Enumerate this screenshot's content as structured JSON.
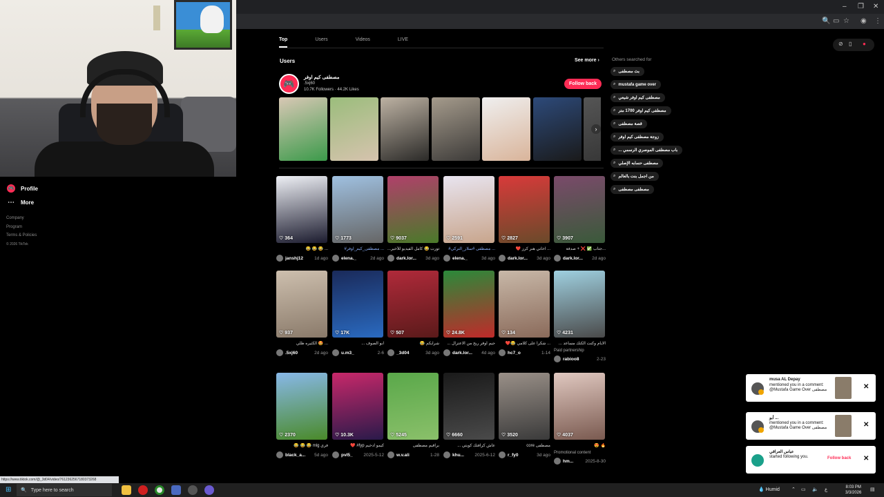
{
  "window": {
    "minimize": "–",
    "restore": "❐",
    "close": "✕"
  },
  "sidebar": {
    "items": [
      {
        "label": "Profile"
      },
      {
        "label": "More"
      }
    ],
    "footer": [
      "Company",
      "Program",
      "Terms & Policies",
      "© 2026 TikTok"
    ]
  },
  "tabs": [
    "Top",
    "Users",
    "Videos",
    "LIVE"
  ],
  "users_section": {
    "title": "Users",
    "see_more": "See more",
    "user": {
      "name": "مصطفى كيم اوفر",
      "id": ".5xj60",
      "stats": "10.7K Followers · 44.2K Likes",
      "follow_label": "Follow back"
    }
  },
  "strip_colors": [
    [
      "#d9c8b5",
      "#3b9a4a"
    ],
    [
      "#9bbd7c",
      "#d6c3ae"
    ],
    [
      "#bdb2a3",
      "#2b2a28"
    ],
    [
      "#a59b8c",
      "#3c3a38"
    ],
    [
      "#efefef",
      "#d9b49a"
    ],
    [
      "#2d4a7a",
      "#1a1a1a"
    ],
    [
      "#555",
      "#333"
    ]
  ],
  "videos": [
    {
      "count": "364",
      "desc": "😂 😂 😂 ...",
      "tag": false,
      "author": "janshj12",
      "date": "1d ago",
      "colors": [
        "#eef0f5",
        "#1b1b2e"
      ]
    },
    {
      "count": "1773",
      "desc": "#مصطفى_كيم_اوفر ...",
      "tag": true,
      "author": "elena._",
      "date": "2d ago",
      "colors": [
        "#9fc0e0",
        "#666"
      ]
    },
    {
      "count": "9037",
      "desc": "...فورت 😂 كامل الفيديو للأخير",
      "tag": false,
      "author": "dark.lor...",
      "date": "3d ago",
      "colors": [
        "#b0406a",
        "#4a7a2a"
      ]
    },
    {
      "count": "2591",
      "desc": "#مصطفى #سلار_التركي ...",
      "tag": true,
      "author": "elena._",
      "date": "3d ago",
      "colors": [
        "#e8e4ef",
        "#c8a58c"
      ]
    },
    {
      "count": "2827",
      "desc": "❤️ آخاني هنر كرز ...",
      "tag": false,
      "author": "dark.lor...",
      "date": "3d ago",
      "colors": [
        "#d83a3a",
        "#6a4a2a"
      ]
    },
    {
      "count": "3907",
      "desc": "جتاب ✅ ❌ + صدفة...",
      "tag": false,
      "author": "dark.lor...",
      "date": "2d ago",
      "colors": [
        "#7a4a6a",
        "#3a5a3a"
      ]
    },
    {
      "count": "937",
      "desc": "الكثيره ظلي 🤩 ...",
      "tag": false,
      "author": ".5xj60",
      "date": "2d ago",
      "colors": [
        "#cdbfae",
        "#8a7a6a"
      ]
    },
    {
      "count": "17K",
      "desc": "... ابو الصوف",
      "tag": false,
      "author": "u.m3_",
      "date": "2-6",
      "colors": [
        "#1a2a5a",
        "#2a6ac0"
      ]
    },
    {
      "count": "507",
      "desc": "😂 شرايكم",
      "tag": false,
      "author": "_3d04",
      "date": "3d ago",
      "colors": [
        "#b02a3a",
        "#5a1a1a"
      ]
    },
    {
      "count": "24.8K",
      "desc": "... جيم اوفر ريح من الاعتزال",
      "tag": false,
      "author": "dark.lor...",
      "date": "4d ago",
      "colors": [
        "#2a8a3a",
        "#c02a2a"
      ]
    },
    {
      "count": "134",
      "desc": "❤️😂 شكراً على كلامي ...",
      "tag": false,
      "author": "hc7_o",
      "date": "1-14",
      "colors": [
        "#c8b8a8",
        "#8a6a5a"
      ]
    },
    {
      "count": "4231",
      "desc": "... الايام وكنت الكنك مساعد",
      "tag": false,
      "author": "rabioo8",
      "date": "2-23",
      "paid": "Paid partnership",
      "colors": [
        "#9fd0e0",
        "#4a4a4a"
      ]
    },
    {
      "count": "2370",
      "desc": "😂 😂 😂 mlg فري",
      "tag": false,
      "author": "black_a...",
      "date": "5d ago",
      "colors": [
        "#88b8e8",
        "#4a8a2a"
      ]
    },
    {
      "count": "10.3K",
      "desc": "❤️ #fyp كيمو ادخيم",
      "tag": false,
      "author": "pvl5_",
      "date": "2025-5-12",
      "colors": [
        "#c8286a",
        "#2a1a4a"
      ]
    },
    {
      "count": "5245",
      "desc": "براقيم مصطفى",
      "tag": false,
      "author": "w.v.ali",
      "date": "1-28",
      "colors": [
        "#5aa84a",
        "#8ac06a"
      ]
    },
    {
      "count": "6660",
      "desc": "... عاش كرافتك كوبتي",
      "tag": false,
      "author": "khu...",
      "date": "2025-6-12",
      "colors": [
        "#1a1a1a",
        "#4a4a4a"
      ]
    },
    {
      "count": "3520",
      "desc": "core مصطفى",
      "tag": false,
      "author": "r_fy0",
      "date": "3d ago",
      "colors": [
        "#9a9088",
        "#3a3a3a"
      ]
    },
    {
      "count": "4037",
      "desc": "😍 🔥",
      "tag": false,
      "author": "hm...",
      "date": "2025-8-30",
      "paid": "Promotional content",
      "colors": [
        "#e0c8c0",
        "#7a5a50"
      ]
    }
  ],
  "others": {
    "title": "Others searched for",
    "items": [
      "بث مصطفى",
      "mustafa game over",
      "مصطفى كيم اوفر شيعي",
      "مصطفى كيم اوفر 1700 متر",
      "قصة مصطفى",
      "زوجة مصطفى كيم اوفر",
      "... باب مصطفى الموصري الرسمي",
      "مصطفى حسابه الإصلي",
      "من اجمل بنت بالعالم",
      "مصطفى مصطفى"
    ]
  },
  "notifications": [
    {
      "name": "musa AL Depay",
      "text": "mentioned you in a comment: @Mustafa Game Over مصطفى",
      "thumb": true
    },
    {
      "name": "أبو ...",
      "text": "mentioned you in a comment: @Mustafa Game Over مصطفى",
      "thumb": true
    },
    {
      "name": "عباس العراقي",
      "text": "started following you.",
      "follow": "Follow back"
    }
  ],
  "status_url": "https://www.tiktok.com/@_3d04/video/7612362567180373268",
  "taskbar": {
    "search": "Type here to search",
    "weather": "Humid",
    "time": "8:03 PM",
    "date": "3/3/2026"
  }
}
